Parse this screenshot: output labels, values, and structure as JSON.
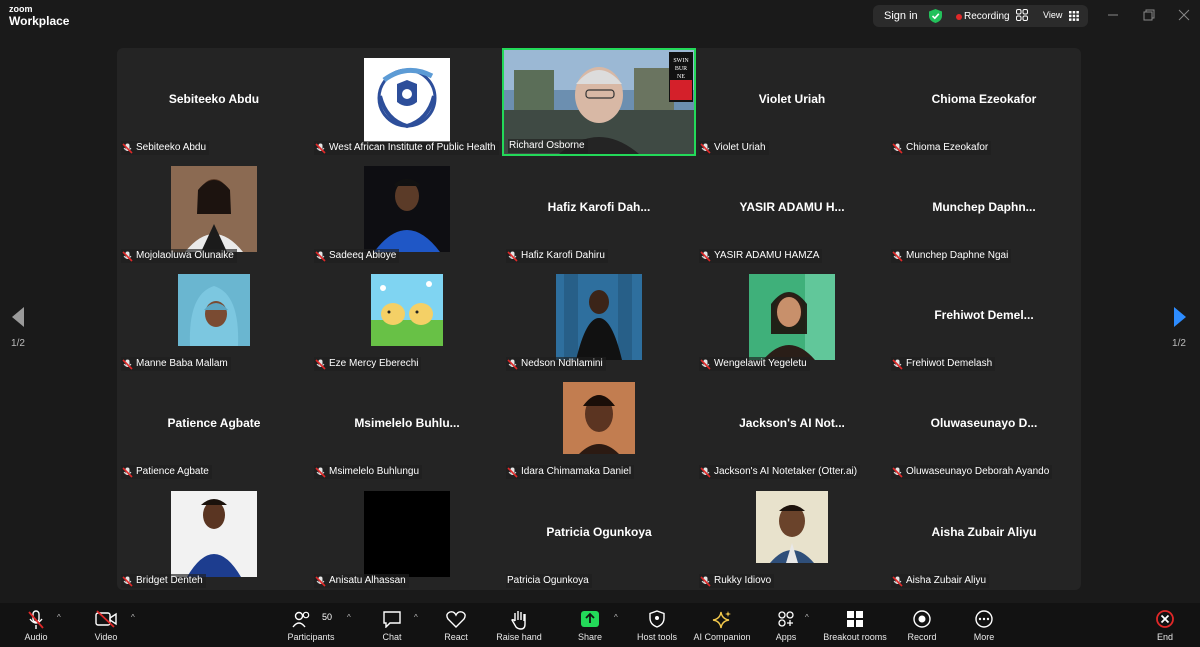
{
  "app": {
    "brand_small": "zoom",
    "brand_big": "Workplace"
  },
  "topbar": {
    "signin": "Sign in",
    "recording": "Recording",
    "view": "View"
  },
  "colors": {
    "speaker_border": "#23d959",
    "recording_dot": "#e02828",
    "share_green": "#23d959",
    "end_red": "#e02828",
    "shield_green": "#23c15b"
  },
  "participants": [
    {
      "name": "Sebiteeko Abdu",
      "display": "Sebiteeko Abdu",
      "muted": true,
      "video": "name"
    },
    {
      "name": "West African Institute of Public Health",
      "display": "",
      "muted": true,
      "video": "logo"
    },
    {
      "name": "Richard Osborne",
      "display": "",
      "muted": false,
      "video": "camera",
      "active_speaker": true,
      "logo_text": "SWIN BUR NE"
    },
    {
      "name": "Violet Uriah",
      "display": "Violet Uriah",
      "muted": true,
      "video": "name"
    },
    {
      "name": "Chioma Ezeokafor",
      "display": "Chioma Ezeokafor",
      "muted": true,
      "video": "name"
    },
    {
      "name": "Mojolaoluwa Olunaike",
      "display": "",
      "muted": true,
      "video": "photo"
    },
    {
      "name": "Sadeeq Abioye",
      "display": "",
      "muted": true,
      "video": "photo"
    },
    {
      "name": "Hafiz Karofi Dahiru",
      "display": "Hafiz Karofi Dah...",
      "muted": true,
      "video": "name"
    },
    {
      "name": "YASIR ADAMU HAMZA",
      "display": "YASIR ADAMU H...",
      "muted": true,
      "video": "name"
    },
    {
      "name": "Munchep Daphne Ngai",
      "display": "Munchep  Daphn...",
      "muted": true,
      "video": "name"
    },
    {
      "name": "Manne Baba Mallam",
      "display": "",
      "muted": true,
      "video": "photo"
    },
    {
      "name": "Eze Mercy Eberechi",
      "display": "",
      "muted": true,
      "video": "photo"
    },
    {
      "name": "Nedson Ndhlamini",
      "display": "",
      "muted": true,
      "video": "photo"
    },
    {
      "name": "Wengelawit Yegeletu",
      "display": "",
      "muted": true,
      "video": "photo"
    },
    {
      "name": "Frehiwot Demelash",
      "display": "Frehiwot  Demel...",
      "muted": true,
      "video": "name"
    },
    {
      "name": "Patience Agbate",
      "display": "Patience Agbate",
      "muted": true,
      "video": "name"
    },
    {
      "name": "Msimelelo Buhlungu",
      "display": "Msimelelo  Buhlu...",
      "muted": true,
      "video": "name"
    },
    {
      "name": "Idara Chimamaka Daniel",
      "display": "",
      "muted": true,
      "video": "photo"
    },
    {
      "name": "Jackson's AI Notetaker (Otter.ai)",
      "display": "Jackson's AI Not...",
      "muted": true,
      "video": "name"
    },
    {
      "name": "Oluwaseunayo Deborah Ayando",
      "display": "Oluwaseunayo  D...",
      "muted": true,
      "video": "name"
    },
    {
      "name": "Bridget Denteh",
      "display": "",
      "muted": true,
      "video": "photo"
    },
    {
      "name": "Anisatu Alhassan",
      "display": "",
      "muted": true,
      "video": "black"
    },
    {
      "name": "Patricia Ogunkoya",
      "display": "Patricia Ogunkoya",
      "muted": false,
      "video": "name"
    },
    {
      "name": "Rukky Idiovo",
      "display": "",
      "muted": true,
      "video": "photo"
    },
    {
      "name": "Aisha Zubair Aliyu",
      "display": "Aisha Zubair Aliyu",
      "muted": true,
      "video": "name"
    }
  ],
  "pagination": {
    "left": "1/2",
    "right": "1/2"
  },
  "toolbar": {
    "audio": "Audio",
    "video": "Video",
    "participants": "Participants",
    "participants_count": "50",
    "chat": "Chat",
    "react": "React",
    "raise_hand": "Raise hand",
    "share": "Share",
    "host_tools": "Host tools",
    "ai_companion": "AI Companion",
    "apps": "Apps",
    "breakout_rooms": "Breakout rooms",
    "record": "Record",
    "more": "More",
    "end": "End"
  }
}
